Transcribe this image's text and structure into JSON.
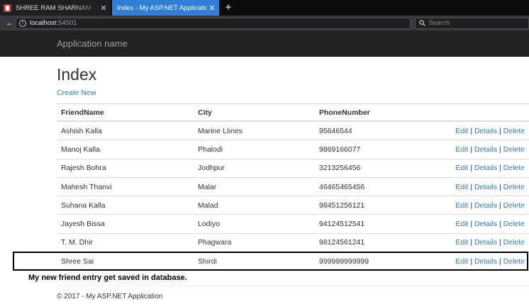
{
  "browser": {
    "tabs": [
      {
        "title": "SHREE RAM SHARNAM - Int",
        "active": false
      },
      {
        "title": "Index - My ASP.NET Application",
        "active": true
      }
    ],
    "new_tab": "+",
    "url_host": "localhost",
    "url_port": ":54501",
    "search_placeholder": "Search"
  },
  "navbar": {
    "brand": "Application name"
  },
  "page": {
    "title": "Index",
    "create_new": "Create New"
  },
  "table": {
    "headers": [
      "FriendName",
      "City",
      "PhoneNumber"
    ],
    "action_labels": {
      "edit": "Edit",
      "details": "Details",
      "delete": "Delete",
      "sep": " | "
    },
    "rows": [
      {
        "name": "Ashish Kalla",
        "city": "Marine LIines",
        "phone": "95646544"
      },
      {
        "name": "Manoj Kalla",
        "city": "Phalodi",
        "phone": "9869166077"
      },
      {
        "name": "Rajesh Bohra",
        "city": "Jodhpur",
        "phone": "3213256456"
      },
      {
        "name": "Mahesh Thanvi",
        "city": "Malar",
        "phone": "46465465456"
      },
      {
        "name": "Suhana Kalla",
        "city": "Malad",
        "phone": "98451256121"
      },
      {
        "name": "Jayesh Bissa",
        "city": "Lodiyo",
        "phone": "94124512541"
      },
      {
        "name": "T. M. Dhir",
        "city": "Phagwara",
        "phone": "98124561241"
      },
      {
        "name": "Shree Sai",
        "city": "Shirdi",
        "phone": "999999999999"
      }
    ]
  },
  "annotation": "My new friend entry get saved in database.",
  "footer": "© 2017 - My ASP.NET Application",
  "colors": {
    "link": "#337ab7",
    "navbar": "#222222",
    "active_tab": "#2f7fd8"
  }
}
